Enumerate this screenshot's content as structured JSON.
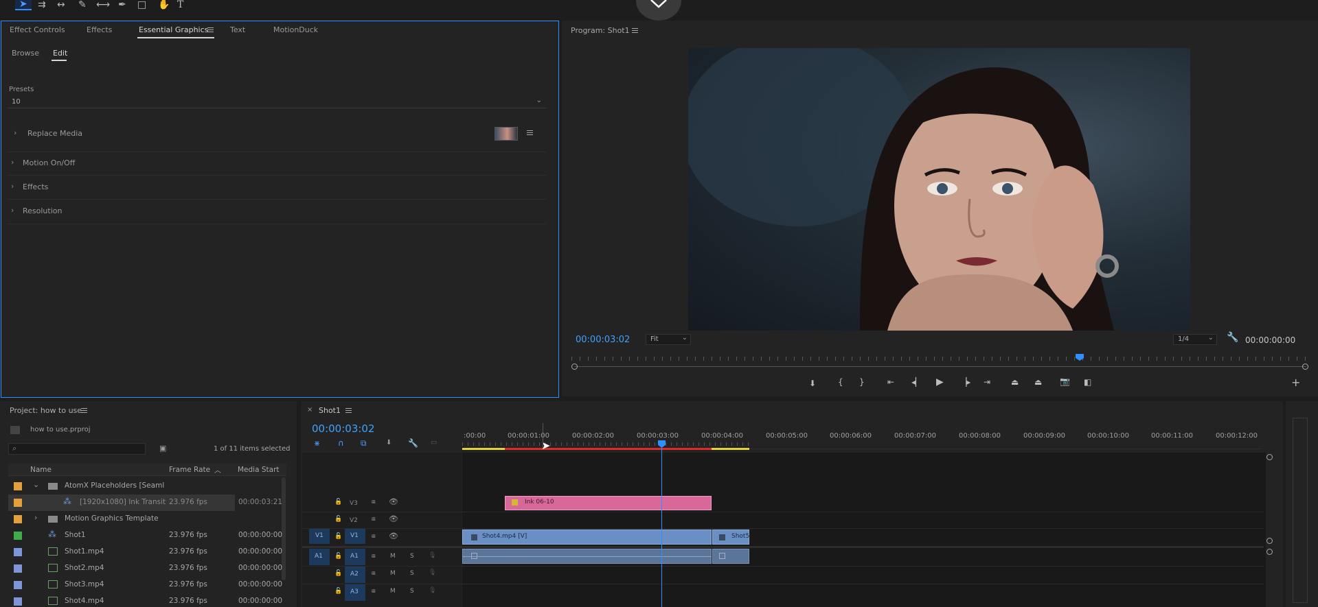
{
  "colors": {
    "accent_blue": "#2f8fff",
    "timecode_blue": "#3ea2ff",
    "clip_pink": "#d8679a",
    "clip_blue": "#6a8fc4",
    "audio_clip": "#5a7598",
    "playhead": "#2f8fff",
    "swatch_orange": "#e4a03a",
    "swatch_green": "#3fae4a",
    "swatch_blue": "#7e95d9"
  },
  "toolbar": {
    "icons": [
      "selection-tool-icon",
      "track-select-tool-icon",
      "ripple-edit-tool-icon",
      "razor-tool-icon",
      "slip-tool-icon",
      "pen-tool-icon",
      "rectangle-tool-icon",
      "hand-tool-icon",
      "type-tool-icon"
    ]
  },
  "effects_panel": {
    "tabs": [
      "Effect Controls",
      "Effects",
      "Essential Graphics",
      "Text",
      "MotionDuck"
    ],
    "active_tab": "Essential Graphics",
    "subtabs": [
      "Browse",
      "Edit"
    ],
    "active_subtab": "Edit",
    "presets_label": "Presets",
    "presets_value": "10",
    "sections": [
      "Replace Media",
      "Motion On/Off",
      "Effects",
      "Resolution"
    ]
  },
  "program": {
    "title": "Program: Shot1",
    "timecode": "00:00:03:02",
    "fit": "Fit",
    "resolution": "1/4",
    "duration": "00:00:00:00",
    "controls": [
      "add-marker-icon",
      "mark-in-icon",
      "mark-out-icon",
      "go-to-in-icon",
      "step-back-icon",
      "play-icon",
      "step-forward-icon",
      "go-to-out-icon",
      "lift-icon",
      "extract-icon",
      "export-frame-icon",
      "comparison-view-icon"
    ],
    "add_button": "+"
  },
  "project": {
    "title": "Project: how to use",
    "file": "how to use.prproj",
    "selection": "1 of 11 items selected",
    "columns": {
      "name": "Name",
      "frame_rate": "Frame Rate",
      "media_start": "Media Start"
    },
    "items": [
      {
        "name": "AtomX Placeholders [Seaml",
        "frame_rate": "",
        "media_start": "",
        "color": "#e4a03a",
        "type": "folder",
        "expanded": true
      },
      {
        "name": "[1920x1080] Ink Transit",
        "frame_rate": "23.976 fps",
        "media_start": "00:00:03:21",
        "color": "#e4a03a",
        "type": "mogrt",
        "selected": true
      },
      {
        "name": "Motion Graphics Template",
        "frame_rate": "",
        "media_start": "",
        "color": "#e4a03a",
        "type": "folder",
        "expanded": false
      },
      {
        "name": "Shot1",
        "frame_rate": "23.976 fps",
        "media_start": "00:00:00:00",
        "color": "#3fae4a",
        "type": "sequence"
      },
      {
        "name": "Shot1.mp4",
        "frame_rate": "23.976 fps",
        "media_start": "00:00:00:00",
        "color": "#7e95d9",
        "type": "video"
      },
      {
        "name": "Shot2.mp4",
        "frame_rate": "23.976 fps",
        "media_start": "00:00:00:00",
        "color": "#7e95d9",
        "type": "video"
      },
      {
        "name": "Shot3.mp4",
        "frame_rate": "23.976 fps",
        "media_start": "00:00:00:00",
        "color": "#7e95d9",
        "type": "video"
      },
      {
        "name": "Shot4.mp4",
        "frame_rate": "23.976 fps",
        "media_start": "00:00:00:00",
        "color": "#7e95d9",
        "type": "video"
      }
    ]
  },
  "timeline": {
    "tab": "Shot1",
    "timecode": "00:00:03:02",
    "ruler": [
      ":00:00",
      "00:00:01:00",
      "00:00:02:00",
      "00:00:03:00",
      "00:00:04:00",
      "00:00:05:00",
      "00:00:06:00",
      "00:00:07:00",
      "00:00:08:00",
      "00:00:09:00",
      "00:00:10:00",
      "00:00:11:00",
      "00:00:12:00"
    ],
    "video_tracks": [
      "V3",
      "V2",
      "V1"
    ],
    "audio_tracks": [
      "A1",
      "A2",
      "A3"
    ],
    "source_v": "V1",
    "source_a": "A1",
    "track_buttons": {
      "mute": "M",
      "solo": "S"
    },
    "clips": {
      "ink": "Ink 06-10",
      "shot4": "Shot4.mp4 [V]",
      "shot5": "Shot5"
    }
  }
}
